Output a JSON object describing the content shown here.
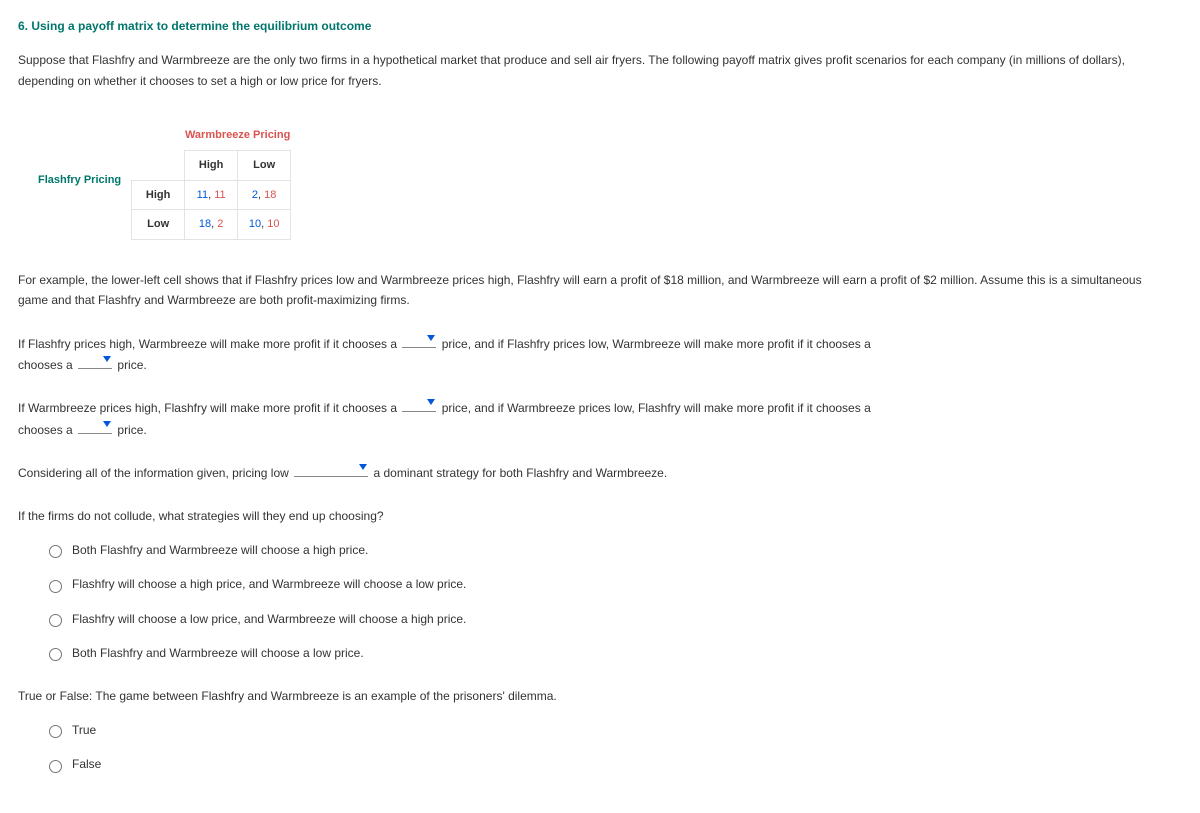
{
  "heading": "6. Using a payoff matrix to determine the equilibrium outcome",
  "intro": "Suppose that Flashfry and Warmbreeze are the only two firms in a hypothetical market that produce and sell air fryers. The following payoff matrix gives profit scenarios for each company (in millions of dollars), depending on whether it chooses to set a high or low price for fryers.",
  "matrix": {
    "colTitle": "Warmbreeze Pricing",
    "rowTitle": "Flashfry Pricing",
    "colLabels": [
      "High",
      "Low"
    ],
    "rowLabels": [
      "High",
      "Low"
    ],
    "cells": {
      "hh_p1": "11",
      "hh_sep": ", ",
      "hh_p2": "11",
      "hl_p1": "2",
      "hl_sep": ", ",
      "hl_p2": "18",
      "lh_p1": "18",
      "lh_sep": ", ",
      "lh_p2": "2",
      "ll_p1": "10",
      "ll_sep": ", ",
      "ll_p2": "10"
    }
  },
  "example": "For example, the lower-left cell shows that if Flashfry prices low and Warmbreeze prices high, Flashfry will earn a profit of $18 million, and Warmbreeze will earn a profit of $2 million. Assume this is a simultaneous game and that Flashfry and Warmbreeze are both profit-maximizing firms.",
  "q1_a": "If Flashfry prices high, Warmbreeze will make more profit if it chooses a",
  "q1_b": "price, and if Flashfry prices low, Warmbreeze will make more profit if it chooses a",
  "q1_c": "price.",
  "q2_a": "If Warmbreeze prices high, Flashfry will make more profit if it chooses a",
  "q2_b": "price, and if Warmbreeze prices low, Flashfry will make more profit if it chooses a",
  "q2_c": "price.",
  "q3_a": "Considering all of the information given, pricing low",
  "q3_b": "a dominant strategy for both Flashfry and Warmbreeze.",
  "q4": "If the firms do not collude, what strategies will they end up choosing?",
  "q4_options": [
    "Both Flashfry and Warmbreeze will choose a high price.",
    "Flashfry will choose a high price, and Warmbreeze will choose a low price.",
    "Flashfry will choose a low price, and Warmbreeze will choose a high price.",
    "Both Flashfry and Warmbreeze will choose a low price."
  ],
  "q5": "True or False: The game between Flashfry and Warmbreeze is an example of the prisoners' dilemma.",
  "q5_options": [
    "True",
    "False"
  ]
}
